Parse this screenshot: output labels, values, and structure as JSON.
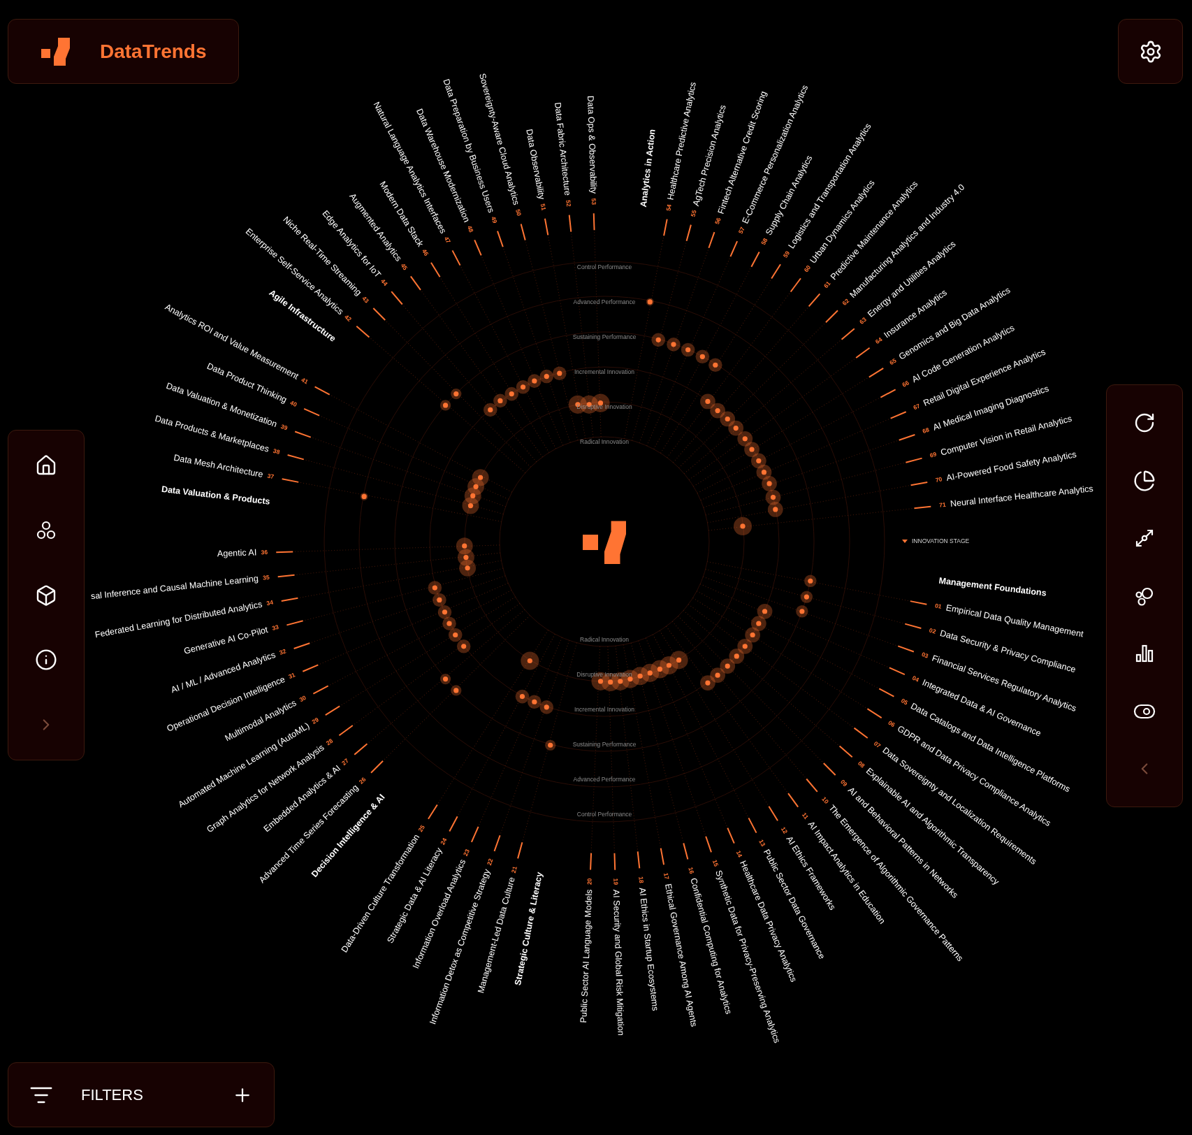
{
  "brand": {
    "name": "DataTrends"
  },
  "legend": {
    "label": "INNOVATION STAGE"
  },
  "ring_labels_top": [
    "Control Performance",
    "Advanced Performance",
    "Sustaining Performance",
    "Incremental Innovation",
    "Disruptive Innovation",
    "Radical Innovation"
  ],
  "ring_labels_bottom": [
    "Radical Innovation",
    "Disruptive Innovation",
    "Incremental Innovation",
    "Sustaining Performance",
    "Advanced Performance",
    "Control Performance"
  ],
  "groups": [
    {
      "title": "Management Foundations",
      "items": [
        {
          "number": "01",
          "name": "Empirical Data Quality Management"
        },
        {
          "number": "02",
          "name": "Data Security & Privacy Compliance"
        },
        {
          "number": "03",
          "name": "Financial Services Regulatory Analytics"
        },
        {
          "number": "04",
          "name": "Integrated Data & AI Governance"
        },
        {
          "number": "05",
          "name": "Data Catalogs and Data Intelligence Platforms"
        },
        {
          "number": "06",
          "name": "GDPR and Data Privacy Compliance Analytics"
        },
        {
          "number": "07",
          "name": "Data Sovereignty and Localization Requirements"
        },
        {
          "number": "08",
          "name": "Explainable AI and Algorithmic Transparency"
        },
        {
          "number": "09",
          "name": "AI and Behavioral Patterns in Networks"
        },
        {
          "number": "10",
          "name": "The Emergence of Algorithmic Governance Patterns"
        },
        {
          "number": "11",
          "name": "AI Impact Analytics in Education"
        },
        {
          "number": "12",
          "name": "AI Ethics Frameworks"
        },
        {
          "number": "13",
          "name": "Public Sector Data Governance"
        },
        {
          "number": "14",
          "name": "Healthcare Data Privacy Analytics"
        },
        {
          "number": "15",
          "name": "Synthetic Data for Privacy-Preserving Analytics"
        },
        {
          "number": "16",
          "name": "Confidential Computing for Analytics"
        },
        {
          "number": "17",
          "name": "Ethical Governance Among AI Agents"
        },
        {
          "number": "18",
          "name": "AI Ethics in Startup Ecosystems"
        },
        {
          "number": "19",
          "name": "AI Security and Global Risk Mitigation"
        },
        {
          "number": "20",
          "name": "Public Sector AI Language Models"
        }
      ]
    },
    {
      "title": "Strategic Culture & Literacy",
      "items": [
        {
          "number": "21",
          "name": "Management-Led Data Culture"
        },
        {
          "number": "22",
          "name": "Information Detox as Competitive Strategy"
        },
        {
          "number": "23",
          "name": "Information Overload Analytics"
        },
        {
          "number": "24",
          "name": "Strategic Data & AI Literacy"
        },
        {
          "number": "25",
          "name": "Data-Driven Culture Transformation"
        }
      ]
    },
    {
      "title": "Decision Intelligence & AI",
      "items": [
        {
          "number": "26",
          "name": "Advanced Time Series Forecasting"
        },
        {
          "number": "27",
          "name": "Embedded Analytics & AI"
        },
        {
          "number": "28",
          "name": "Graph Analytics for Network Analysis"
        },
        {
          "number": "29",
          "name": "Automated Machine Learning (AutoML)"
        },
        {
          "number": "30",
          "name": "Multimodal Analytics"
        },
        {
          "number": "31",
          "name": "Operational Decision Intelligence"
        },
        {
          "number": "32",
          "name": "AI / ML / Advanced Analytics"
        },
        {
          "number": "33",
          "name": "Generative AI Co-Pilot"
        },
        {
          "number": "34",
          "name": "Federated Learning for Distributed Analytics"
        },
        {
          "number": "35",
          "name": "sal Inference and Causal Machine Learning"
        },
        {
          "number": "36",
          "name": "Agentic AI"
        }
      ]
    },
    {
      "title": "Data Valuation & Products",
      "items": [
        {
          "number": "37",
          "name": "Data Mesh Architecture"
        },
        {
          "number": "38",
          "name": "Data Products & Marketplaces"
        },
        {
          "number": "39",
          "name": "Data Valuation & Monetization"
        },
        {
          "number": "40",
          "name": "Data Product Thinking"
        },
        {
          "number": "41",
          "name": "Analytics ROI and Value Measurement"
        }
      ]
    },
    {
      "title": "Agile Infrastructure",
      "items": [
        {
          "number": "42",
          "name": "Enterprise Self-Service Analytics"
        },
        {
          "number": "43",
          "name": "Niche Real-Time Streaming"
        },
        {
          "number": "44",
          "name": "Edge Analytics for IoT"
        },
        {
          "number": "45",
          "name": "Augmented Analytics"
        },
        {
          "number": "46",
          "name": "Modern Data Stack"
        },
        {
          "number": "47",
          "name": "Natural Language Analytics Interfaces"
        },
        {
          "number": "48",
          "name": "Data Warehouse Modernization"
        },
        {
          "number": "49",
          "name": "Data Preparation by Business Users"
        },
        {
          "number": "50",
          "name": "Sovereignty-Aware Cloud Analytics"
        },
        {
          "number": "51",
          "name": "Data Observability"
        },
        {
          "number": "52",
          "name": "Data Fabric Architecture"
        },
        {
          "number": "53",
          "name": "Data Ops & Observability"
        }
      ]
    },
    {
      "title": "Analytics in Action",
      "items": [
        {
          "number": "54",
          "name": "Healthcare Predictive Analytics"
        },
        {
          "number": "55",
          "name": "AgTech Precision Analytics"
        },
        {
          "number": "56",
          "name": "Fintech Alternative Credit Scoring"
        },
        {
          "number": "57",
          "name": "E-Commerce Personalization Analytics"
        },
        {
          "number": "58",
          "name": "Supply Chain Analytics"
        },
        {
          "number": "59",
          "name": "Logistics and Transportation Analytics"
        },
        {
          "number": "60",
          "name": "Urban Dynamics Analytics"
        },
        {
          "number": "61",
          "name": "Predictive Maintenance Analytics"
        },
        {
          "number": "62",
          "name": "Manufacturing Analytics and Industry 4.0"
        },
        {
          "number": "63",
          "name": "Energy and Utilities Analytics"
        },
        {
          "number": "64",
          "name": "Insurance Analytics"
        },
        {
          "number": "65",
          "name": "Genomics and Big Data Analytics"
        },
        {
          "number": "66",
          "name": "AI Code Generation Analytics"
        },
        {
          "number": "67",
          "name": "Retail Digital Experience Analytics"
        },
        {
          "number": "68",
          "name": "AI Medical Imaging Diagnostics"
        },
        {
          "number": "69",
          "name": "Computer Vision in Retail Analytics"
        },
        {
          "number": "70",
          "name": "AI-Powered Food Safety Analytics"
        },
        {
          "number": "71",
          "name": "Neural Interface Healthcare Analytics"
        }
      ]
    }
  ],
  "filters": {
    "label": "FILTERS"
  }
}
